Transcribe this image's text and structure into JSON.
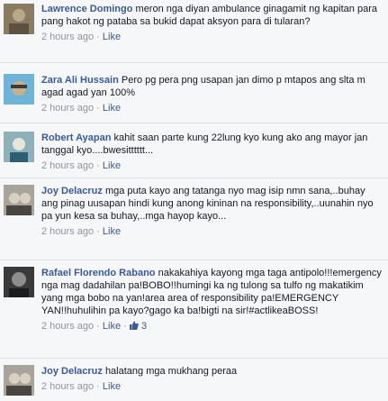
{
  "comments": [
    {
      "author": "Lawrence Domingo",
      "text": "meron nga diyan ambulance ginagamit ng kapitan para pang hakot ng pataba sa bukid dapat aksyon para di tularan?",
      "time": "2 hours ago",
      "like_label": "Like",
      "separator": "·",
      "avatar_colors": [
        "#8a7b63",
        "#b9a98a",
        "#5d5242"
      ]
    },
    {
      "author": "Zara Ali Hussain",
      "text": "Pero pg pera png usapan jan dimo p mtapos ang slta m agad agad yan 100%",
      "time": "2 hours ago",
      "like_label": "Like",
      "separator": "·",
      "avatar_colors": [
        "#6fb4d6",
        "#c8b08a",
        "#3c3c3c"
      ]
    },
    {
      "author": "Robert Ayapan",
      "text": "kahit saan parte kung 22lung kyo kung ako ang mayor jan tanggal kyo....bwesitttttt...",
      "time": "2 hours ago",
      "like_label": "Like",
      "separator": "·",
      "avatar_colors": [
        "#8fb0b8",
        "#2d5f73",
        "#e7e4dc"
      ]
    },
    {
      "author": "Joy Delacruz",
      "text": "mga puta kayo ang tatanga nyo mag isip nmn sana,..buhay ang pinag uusapan hindi kung anong kininan na responsibility,..uunahin nyo pa yun kesa sa buhay,..mga hayop kayo...",
      "time": "2 hours ago",
      "like_label": "Like",
      "separator": "·",
      "avatar_colors": [
        "#a8a49c",
        "#d8d0c2",
        "#4a4540"
      ]
    },
    {
      "author": "Rafael Florendo Rabano",
      "text": "nakakahiya kayong mga taga antipolo!!!emergency nga mag dadahilan pa!BOBO!!humingi ka ng tulong sa tulfo ng makatikim yang mga bobo na yan!area area of responsibility pa!EMERGENCY YAN!!huhulihin pa kayo?gago ka ba!bigti na sir!#actlikeaBOSS!",
      "time": "2 hours ago",
      "like_label": "Like",
      "separator": "·",
      "like_count": "3",
      "avatar_colors": [
        "#3a3a3a",
        "#8d8d8d",
        "#1c1c1c"
      ]
    },
    {
      "author": "Joy Delacruz",
      "text": "halatang mga mukhang peraa",
      "time": "2 hours ago",
      "like_label": "Like",
      "separator": "·",
      "avatar_colors": [
        "#a8a49c",
        "#d8d0c2",
        "#4a4540"
      ]
    }
  ]
}
